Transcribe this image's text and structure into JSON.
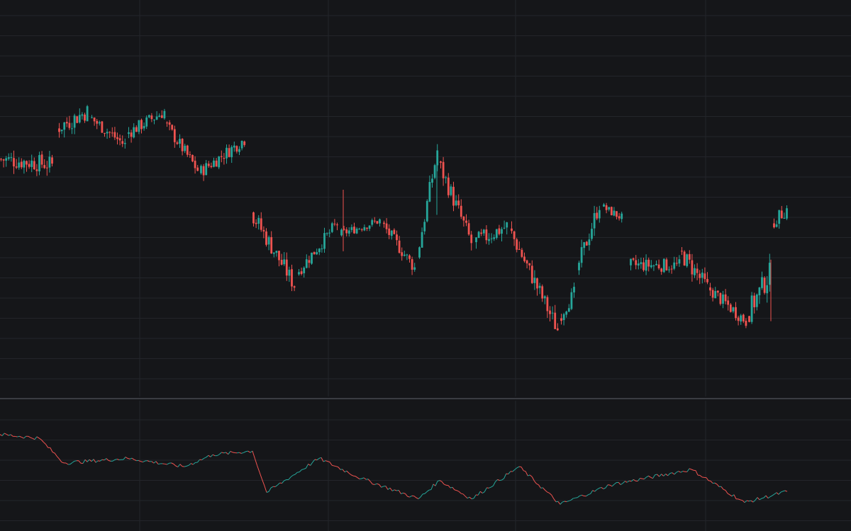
{
  "theme": {
    "background": "#151619",
    "grid": "#23252a",
    "divider": "#3a3c42",
    "up": "#26a69a",
    "down": "#ef5350"
  },
  "chart_data": [
    {
      "type": "candlestick",
      "title": "",
      "xlabel": "",
      "ylabel": "",
      "grid": true,
      "ylim": [
        0,
        100
      ],
      "segments": [
        {
          "x_start": 0,
          "x_end": 78,
          "open": 71,
          "close": 69,
          "amplitude": 4
        },
        {
          "x_start": 82,
          "x_end": 128,
          "open": 82,
          "close": 88,
          "amplitude": 4
        },
        {
          "x_start": 128,
          "x_end": 180,
          "open": 86,
          "close": 76,
          "amplitude": 3
        },
        {
          "x_start": 180,
          "x_end": 234,
          "open": 80,
          "close": 88,
          "amplitude": 3
        },
        {
          "x_start": 234,
          "x_end": 282,
          "open": 84,
          "close": 67,
          "amplitude": 3
        },
        {
          "x_start": 282,
          "x_end": 350,
          "open": 66,
          "close": 78,
          "amplitude": 3
        },
        {
          "x_start": 356,
          "x_end": 420,
          "open": 52,
          "close": 26,
          "amplitude": 4
        },
        {
          "x_start": 420,
          "x_end": 480,
          "open": 30,
          "close": 48,
          "amplitude": 3
        },
        {
          "x_start": 480,
          "x_end": 540,
          "open": 44,
          "close": 49,
          "amplitude": 2
        },
        {
          "x_start": 540,
          "x_end": 590,
          "open": 48,
          "close": 32,
          "amplitude": 3
        },
        {
          "x_start": 590,
          "x_end": 620,
          "open": 36,
          "close": 74,
          "amplitude": 4
        },
        {
          "x_start": 620,
          "x_end": 670,
          "open": 70,
          "close": 41,
          "amplitude": 4
        },
        {
          "x_start": 670,
          "x_end": 720,
          "open": 41,
          "close": 47,
          "amplitude": 4
        },
        {
          "x_start": 720,
          "x_end": 790,
          "open": 46,
          "close": 10,
          "amplitude": 4
        },
        {
          "x_start": 790,
          "x_end": 815,
          "open": 14,
          "close": 23,
          "amplitude": 3
        },
        {
          "x_start": 815,
          "x_end": 850,
          "open": 31,
          "close": 55,
          "amplitude": 4
        },
        {
          "x_start": 850,
          "x_end": 882,
          "open": 54,
          "close": 50,
          "amplitude": 2
        },
        {
          "x_start": 888,
          "x_end": 960,
          "open": 33,
          "close": 33,
          "amplitude": 3
        },
        {
          "x_start": 960,
          "x_end": 1000,
          "open": 38,
          "close": 25,
          "amplitude": 4
        },
        {
          "x_start": 1000,
          "x_end": 1055,
          "open": 25,
          "close": 13,
          "amplitude": 3
        },
        {
          "x_start": 1055,
          "x_end": 1090,
          "open": 15,
          "close": 30,
          "amplitude": 5
        },
        {
          "x_start": 1090,
          "x_end": 1112,
          "open": 48,
          "close": 53,
          "amplitude": 3
        }
      ],
      "spikes": [
        {
          "x": 484,
          "high": 60
        },
        {
          "x": 616,
          "high": 73
        },
        {
          "x": 1087,
          "high": 35
        }
      ]
    },
    {
      "type": "line",
      "title": "",
      "xlabel": "",
      "ylabel": "",
      "grid": true,
      "ylim": [
        0,
        100
      ],
      "segments": [
        {
          "x_start": 0,
          "x_end": 55,
          "y_start": 88,
          "y_end": 84
        },
        {
          "x_start": 55,
          "x_end": 90,
          "y_start": 84,
          "y_end": 57
        },
        {
          "x_start": 90,
          "x_end": 180,
          "y_start": 57,
          "y_end": 62
        },
        {
          "x_start": 180,
          "x_end": 260,
          "y_start": 62,
          "y_end": 53
        },
        {
          "x_start": 260,
          "x_end": 300,
          "y_start": 53,
          "y_end": 66
        },
        {
          "x_start": 300,
          "x_end": 356,
          "y_start": 66,
          "y_end": 70
        },
        {
          "x_start": 356,
          "x_end": 376,
          "y_start": 70,
          "y_end": 25
        },
        {
          "x_start": 376,
          "x_end": 450,
          "y_start": 25,
          "y_end": 62
        },
        {
          "x_start": 450,
          "x_end": 510,
          "y_start": 62,
          "y_end": 40
        },
        {
          "x_start": 510,
          "x_end": 590,
          "y_start": 40,
          "y_end": 18
        },
        {
          "x_start": 590,
          "x_end": 620,
          "y_start": 18,
          "y_end": 38
        },
        {
          "x_start": 620,
          "x_end": 665,
          "y_start": 38,
          "y_end": 18
        },
        {
          "x_start": 665,
          "x_end": 732,
          "y_start": 18,
          "y_end": 53
        },
        {
          "x_start": 732,
          "x_end": 790,
          "y_start": 53,
          "y_end": 12
        },
        {
          "x_start": 790,
          "x_end": 860,
          "y_start": 12,
          "y_end": 33
        },
        {
          "x_start": 860,
          "x_end": 975,
          "y_start": 33,
          "y_end": 50
        },
        {
          "x_start": 975,
          "x_end": 1050,
          "y_start": 50,
          "y_end": 14
        },
        {
          "x_start": 1050,
          "x_end": 1110,
          "y_start": 14,
          "y_end": 26
        }
      ]
    }
  ]
}
